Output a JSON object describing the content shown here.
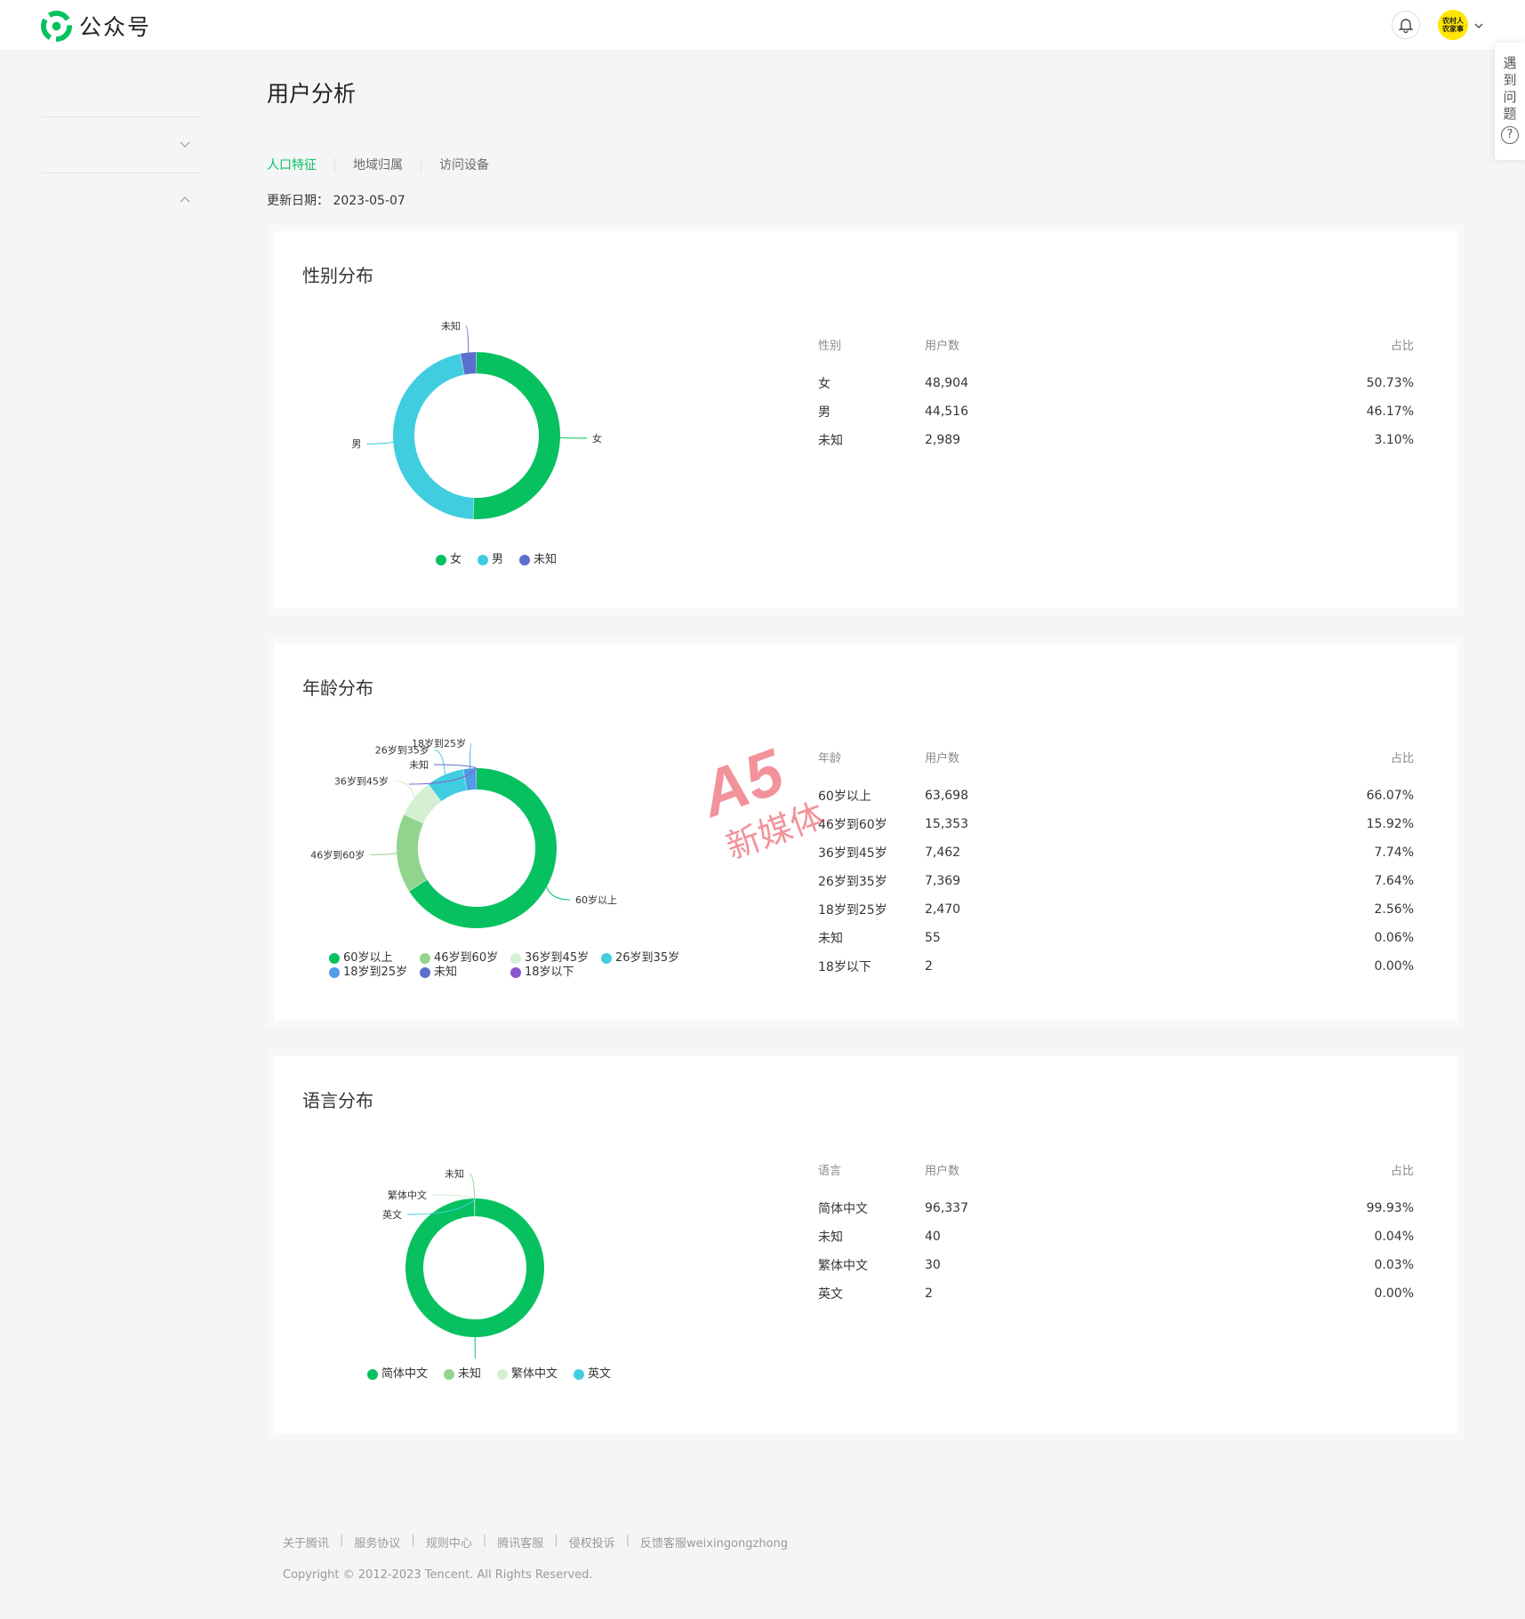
{
  "header": {
    "app_title": "公众号",
    "avatar_text": "农村人农家事"
  },
  "help_tab": {
    "chars": [
      "遇",
      "到",
      "问",
      "题"
    ],
    "icon": "question-icon"
  },
  "page": {
    "title": "用户分析",
    "tabs": [
      "人口特征",
      "地域归属",
      "访问设备"
    ],
    "active_tab": "人口特征",
    "update_label": "更新日期：",
    "update_date": "2023-05-07"
  },
  "colors": {
    "accent": "#07c160",
    "green": "#07c160",
    "light_green": "#91d48d",
    "pale_green": "#d4efd2",
    "cyan": "#41cde0",
    "blue": "#4f9de6",
    "indigo": "#5b6fcf",
    "purple": "#8a57cf"
  },
  "gender": {
    "title": "性别分布",
    "headers": {
      "col1": "性别",
      "col2": "用户数",
      "col3": "占比"
    },
    "rows": [
      {
        "name": "女",
        "count": "48,904",
        "pct": "50.73%"
      },
      {
        "name": "男",
        "count": "44,516",
        "pct": "46.17%"
      },
      {
        "name": "未知",
        "count": "2,989",
        "pct": "3.10%"
      }
    ]
  },
  "age": {
    "title": "年龄分布",
    "headers": {
      "col1": "年龄",
      "col2": "用户数",
      "col3": "占比"
    },
    "rows": [
      {
        "name": "60岁以上",
        "count": "63,698",
        "pct": "66.07%"
      },
      {
        "name": "46岁到60岁",
        "count": "15,353",
        "pct": "15.92%"
      },
      {
        "name": "36岁到45岁",
        "count": "7,462",
        "pct": "7.74%"
      },
      {
        "name": "26岁到35岁",
        "count": "7,369",
        "pct": "7.64%"
      },
      {
        "name": "18岁到25岁",
        "count": "2,470",
        "pct": "2.56%"
      },
      {
        "name": "未知",
        "count": "55",
        "pct": "0.06%"
      },
      {
        "name": "18岁以下",
        "count": "2",
        "pct": "0.00%"
      }
    ]
  },
  "language": {
    "title": "语言分布",
    "headers": {
      "col1": "语言",
      "col2": "用户数",
      "col3": "占比"
    },
    "rows": [
      {
        "name": "简体中文",
        "count": "96,337",
        "pct": "99.93%"
      },
      {
        "name": "未知",
        "count": "40",
        "pct": "0.04%"
      },
      {
        "name": "繁体中文",
        "count": "30",
        "pct": "0.03%"
      },
      {
        "name": "英文",
        "count": "2",
        "pct": "0.00%"
      }
    ]
  },
  "chart_data": [
    {
      "type": "pie",
      "categories": [
        "女",
        "男",
        "未知"
      ],
      "values": [
        48904,
        44516,
        2989
      ],
      "legend": "bottom",
      "colors": [
        "#07c160",
        "#41cde0",
        "#5b6fcf"
      ]
    },
    {
      "type": "pie",
      "categories": [
        "60岁以上",
        "46岁到60岁",
        "36岁到45岁",
        "26岁到35岁",
        "18岁到25岁",
        "未知",
        "18岁以下"
      ],
      "values": [
        63698,
        15353,
        7462,
        7369,
        2470,
        55,
        2
      ],
      "legend": "bottom",
      "colors": [
        "#07c160",
        "#91d48d",
        "#d4efd2",
        "#41cde0",
        "#4f9de6",
        "#5b6fcf",
        "#8a57cf"
      ]
    },
    {
      "type": "pie",
      "categories": [
        "简体中文",
        "未知",
        "繁体中文",
        "英文"
      ],
      "values": [
        96337,
        40,
        30,
        2
      ],
      "legend": "bottom",
      "colors": [
        "#07c160",
        "#91d48d",
        "#d4efd2",
        "#41cde0"
      ]
    }
  ],
  "watermark": {
    "logo_text": "A5",
    "sub_text": "新媒体"
  },
  "footer": {
    "links": [
      "关于腾讯",
      "服务协议",
      "规则中心",
      "腾讯客服",
      "侵权投诉",
      "反馈客服weixingongzhong"
    ],
    "copyright": "Copyright © 2012-2023 Tencent. All Rights Reserved."
  }
}
